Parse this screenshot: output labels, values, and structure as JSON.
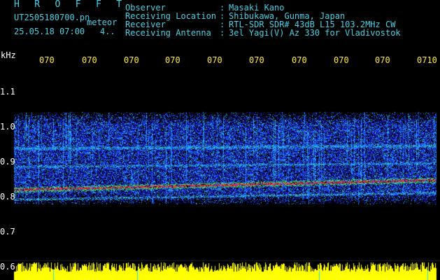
{
  "header": {
    "brand": "H R O F F T",
    "file_name": "UT2505180700.pn",
    "meteor_label": "meteor",
    "datetime": "25.05.18 07:00",
    "count": "4..",
    "labels": [
      "Observer",
      "Receiving Location",
      "Receiver",
      "Receiving Antenna"
    ],
    "colons": [
      ":",
      ":",
      ":",
      ":"
    ],
    "values": [
      "Masaki Kano",
      "Shibukawa, Gunma, Japan",
      "RTL-SDR SDR# 43dB L15 103.2MHz CW",
      "3el Yagi(V) Az 330 for Vladivostok"
    ]
  },
  "plot": {
    "unit": "kHz",
    "x_ticks": [
      "070",
      "070",
      "070",
      "070",
      "070",
      "070",
      "070",
      "070",
      "070",
      "0710"
    ],
    "y_ticks": [
      "1.1",
      "1.0",
      "0.9",
      "0.8",
      "0.7",
      "0.6"
    ],
    "colors": {
      "background": "#000000",
      "axis_text": "#ffea3a",
      "cyan_text": "#49d0e6",
      "noise_low": "#1a1ad8",
      "noise_mid": "#1e8cff",
      "trace": "#ff3030",
      "strip": "#ffff00",
      "strip_line": "#18e0ff"
    }
  }
}
